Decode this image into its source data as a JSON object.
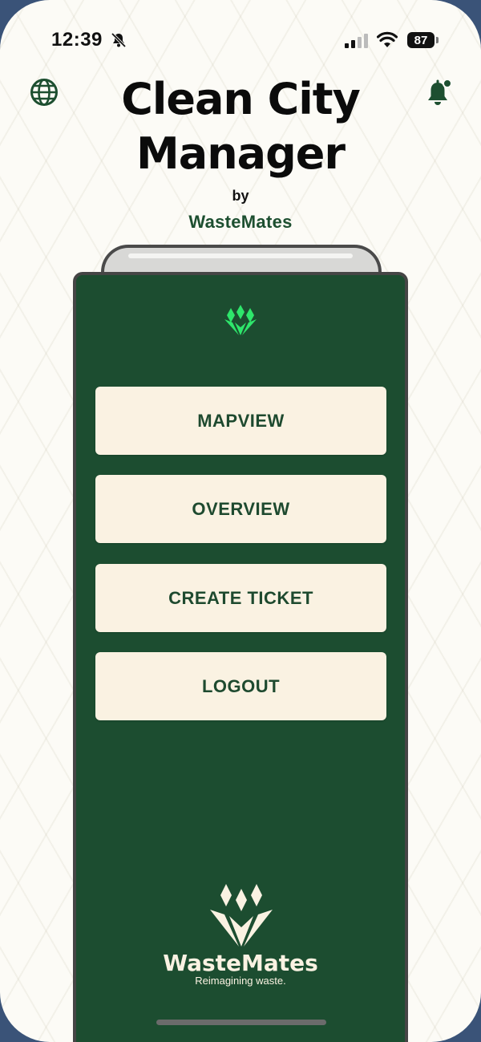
{
  "status_bar": {
    "time": "12:39",
    "battery": "87",
    "icons": [
      "bell-slash-icon",
      "cellular-signal-icon",
      "wifi-icon",
      "battery-icon"
    ]
  },
  "header": {
    "globe_icon": "globe-icon",
    "alert_icon": "notification-bell-icon",
    "title_line1": "Clean City",
    "title_line2": "Manager",
    "by": "by",
    "brand": "WasteMates"
  },
  "menu": {
    "items": [
      {
        "label": "MAPVIEW"
      },
      {
        "label": "OVERVIEW"
      },
      {
        "label": "CREATE TICKET"
      },
      {
        "label": "LOGOUT"
      }
    ]
  },
  "footer": {
    "brand": "WasteMates",
    "tagline": "Reimagining waste."
  },
  "colors": {
    "primary_green": "#1c4d30",
    "accent_green": "#2ee66b",
    "button_bg": "#faf2e2",
    "button_text": "#1e4a2f"
  }
}
